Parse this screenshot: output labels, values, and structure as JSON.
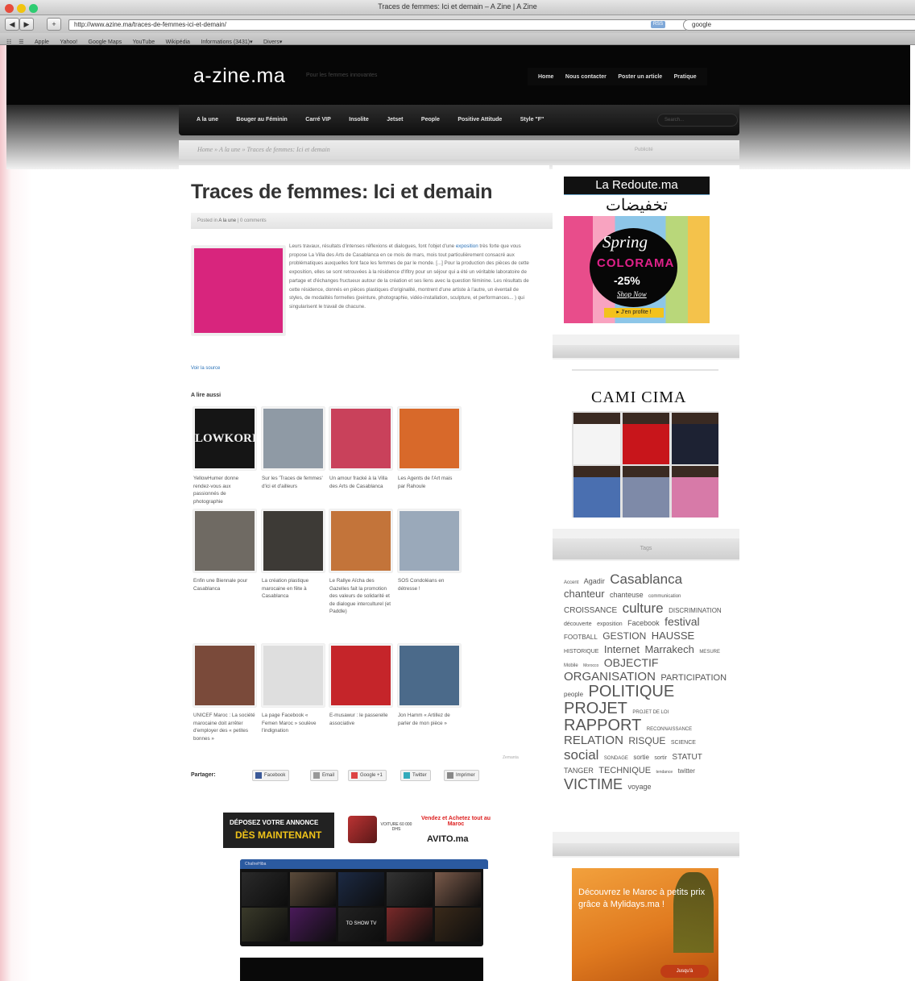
{
  "browser": {
    "window_title": "Traces de femmes: Ici et demain – A Zine | A Zine",
    "url": "http://www.azine.ma/traces-de-femmes-ici-et-demain/",
    "search_query": "google",
    "rss_label": "RSS",
    "bookmarks": [
      "Apple",
      "Yahoo!",
      "Google Maps",
      "YouTube",
      "Wikipédia",
      "Informations (3431)▾",
      "Divers▾"
    ]
  },
  "site": {
    "logo": "a-zine.ma",
    "tagline": "Pour les femmes innovantes",
    "top_links": [
      "Home",
      "Nous contacter",
      "Poster un article",
      "Pratique"
    ],
    "nav": [
      "A la une",
      "Bouger au Féminin",
      "Carré VIP",
      "Insolite",
      "Jetset",
      "People",
      "Positive Attitude",
      "Style \"F\""
    ],
    "search_placeholder": "Search..."
  },
  "breadcrumb": "Home » A la une » Traces de femmes: Ici et demain",
  "sidebar_pub_label": "Publicité",
  "article": {
    "title": "Traces de femmes: Ici et demain",
    "meta_prefix": "Posted in",
    "meta_category": "A la une",
    "meta_comments": "0 comments",
    "body_before_link": "Leurs travaux, résultats d'intenses réflexions et dialogues, font l'objet d'une ",
    "body_link": "exposition",
    "body_after_link": " très forte que vous propose La Villa des Arts de Casablanca en ce mois de mars, mois tout particulièrement consacré aux problématiques auxquelles font face les femmes de par le monde. [...] Pour la production des pièces de cette exposition, elles se sont retrouvées à la résidence d'Ifitry pour un séjour qui a été un véritable laboratoire de partage et d'échanges fructueux autour de la création et ses liens avec la question féminine. Les résultats de cette résidence, donnés en pièces plastiques d'originalité, montrent d'une artiste à l'autre, un éventail de styles, de modalités formelles (peinture, photographie, vidéo-installation, sculpture, et performances... ) qui singularisent le travail de chacune.",
    "source_link": "Voir la source"
  },
  "related": {
    "heading": "A lire aussi",
    "items": [
      {
        "caption": "YellowHumer donne rendez-vous aux passionnés de photographie",
        "color": "#151515",
        "thumb_text": "LOWKORI"
      },
      {
        "caption": "Sur les 'Traces de femmes' d'ici et d'ailleurs",
        "color": "#8f9aa5",
        "thumb_text": ""
      },
      {
        "caption": "Un amour fracké à la Villa des Arts de Casablanca",
        "color": "#c9415b",
        "thumb_text": ""
      },
      {
        "caption": "Les Agents de l'Art mais par Rahoule",
        "color": "#d8692a",
        "thumb_text": ""
      },
      {
        "caption": "Enfin une Biennale pour Casablanca",
        "color": "#6f6a63",
        "thumb_text": ""
      },
      {
        "caption": "La création plastique marocaine en fête à Casablanca",
        "color": "#3d3a36",
        "thumb_text": ""
      },
      {
        "caption": "Le Rallye Aïcha des Gazelles fait la promotion des valeurs de solidarité et de dialogue interculturel (et Paddle)",
        "color": "#c3743a",
        "thumb_text": ""
      },
      {
        "caption": "SOS Condoléans en détresse !",
        "color": "#9aa9ba",
        "thumb_text": ""
      },
      {
        "caption": "UNICEF Maroc : La société marocaine doit arrêter d'employer des « petites bonnes »",
        "color": "#7a4a3a",
        "thumb_text": ""
      },
      {
        "caption": "La page Facebook « Femen Maroc » soulève l'indignation",
        "color": "#dedede",
        "thumb_text": ""
      },
      {
        "caption": "E-musawur : le passerelle associative",
        "color": "#c5252a",
        "thumb_text": ""
      },
      {
        "caption": "Jon Hamm « Artillez de parler de mon pièce »",
        "color": "#4b6a8a",
        "thumb_text": ""
      }
    ],
    "footer_label": "Zemanta"
  },
  "share": {
    "label": "Partager:",
    "buttons": [
      "Facebook",
      "Email",
      "Google +1",
      "Twitter",
      "Imprimer"
    ]
  },
  "ad_avito": {
    "line1": "DÉPOSEZ VOTRE ANNONCE",
    "line2": "DÈS MAINTENANT",
    "middle": "VOITURE 60 000 DHS",
    "right1": "Vendez et Achetez tout au Maroc",
    "brand": "AVITO.ma"
  },
  "video_widget": {
    "header": "ChaîneHiba",
    "thumbs": [
      "#2a2a2a",
      "#5a4a3a",
      "#1c2a44",
      "#333",
      "#7a5a4a",
      "#3a3a2a",
      "#4a1a5a",
      "#222",
      "#7a2a2a",
      "#3a2a1a"
    ],
    "thumb_label": "TO SHOW TV"
  },
  "redoute_ad": {
    "brand": "La Redoute.ma",
    "arabic": "تخفيضات",
    "spring": "Spring",
    "colorama": "COLORAMA",
    "discount": "-25%",
    "shop_now": "Shop Now",
    "profite": "▸ J'en profite !"
  },
  "cami_ad": {
    "brand": "CAMI CIMA",
    "shirts": [
      "#f4f4f4",
      "#c8151b",
      "#1d2233",
      "#4a6fb0",
      "#7e8aa8",
      "#d77aa8"
    ]
  },
  "tags": {
    "heading": "Tags",
    "items": [
      {
        "t": "Accent",
        "s": 6
      },
      {
        "t": "Agadir",
        "s": 9
      },
      {
        "t": "Casablanca",
        "s": 17
      },
      {
        "t": "chanteur",
        "s": 13
      },
      {
        "t": "chanteuse",
        "s": 9
      },
      {
        "t": "communication",
        "s": 6
      },
      {
        "t": "CROISSANCE",
        "s": 10
      },
      {
        "t": "culture",
        "s": 17
      },
      {
        "t": "DISCRIMINATION",
        "s": 8
      },
      {
        "t": "découverte",
        "s": 7
      },
      {
        "t": "exposition",
        "s": 7
      },
      {
        "t": "Facebook",
        "s": 9
      },
      {
        "t": "festival",
        "s": 14
      },
      {
        "t": "FOOTBALL",
        "s": 8
      },
      {
        "t": "GESTION",
        "s": 12
      },
      {
        "t": "HAUSSE",
        "s": 13
      },
      {
        "t": "HISTORIQUE",
        "s": 7
      },
      {
        "t": "Internet",
        "s": 13
      },
      {
        "t": "Marrakech",
        "s": 13
      },
      {
        "t": "MESURE",
        "s": 6
      },
      {
        "t": "Mobile",
        "s": 6
      },
      {
        "t": "Morocco",
        "s": 5
      },
      {
        "t": "OBJECTIF",
        "s": 14
      },
      {
        "t": "ORGANISATION",
        "s": 15
      },
      {
        "t": "PARTICIPATION",
        "s": 11
      },
      {
        "t": "people",
        "s": 8
      },
      {
        "t": "POLITIQUE",
        "s": 20
      },
      {
        "t": "PROJET",
        "s": 20
      },
      {
        "t": "PROJET DE LOI",
        "s": 6
      },
      {
        "t": "RAPPORT",
        "s": 20
      },
      {
        "t": "RECONNAISSANCE",
        "s": 6
      },
      {
        "t": "RELATION",
        "s": 15
      },
      {
        "t": "RISQUE",
        "s": 12
      },
      {
        "t": "SCIENCE",
        "s": 7
      },
      {
        "t": "social",
        "s": 17
      },
      {
        "t": "SONDAGE",
        "s": 6
      },
      {
        "t": "sortie",
        "s": 8
      },
      {
        "t": "sortir",
        "s": 7
      },
      {
        "t": "STATUT",
        "s": 10
      },
      {
        "t": "TANGER",
        "s": 9
      },
      {
        "t": "TECHNIQUE",
        "s": 11
      },
      {
        "t": "tendance",
        "s": 5
      },
      {
        "t": "twitter",
        "s": 8
      },
      {
        "t": "VICTIME",
        "s": 18
      },
      {
        "t": "voyage",
        "s": 9
      }
    ]
  },
  "mylidays_ad": {
    "text": "Découvrez le Maroc à petits prix grâce à Mylidays.ma !",
    "button": "Jusqu'à"
  }
}
